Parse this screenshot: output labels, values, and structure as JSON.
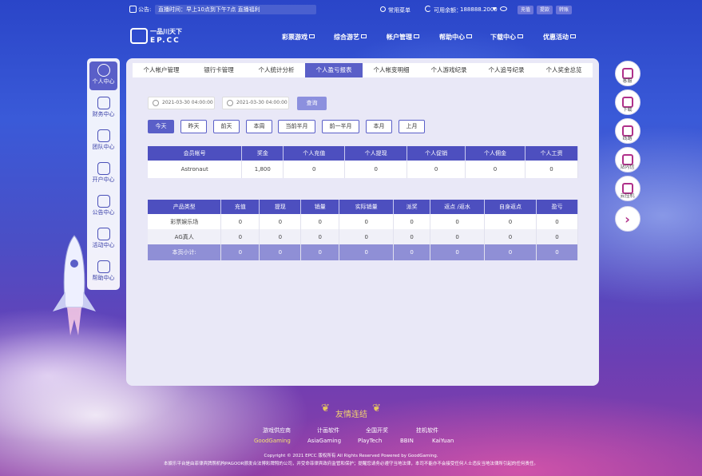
{
  "topbar": {
    "notice_label": "公告:",
    "notice_text": "直播时间：早上10点到下午7点 直播福利",
    "common_menu": "常用菜单",
    "balance_label": "可用余额：",
    "balance_value": "188888.2000",
    "buttons": [
      "充值",
      "提款",
      "转账"
    ]
  },
  "logo": {
    "title": "一品川天下",
    "sub": "EP.CC"
  },
  "nav": [
    "彩票游戏",
    "综合游艺",
    "帐户管理",
    "帮助中心",
    "下载中心",
    "优惠活动"
  ],
  "left_sidebar": [
    "个人中心",
    "财务中心",
    "团队中心",
    "开户中心",
    "公告中心",
    "活动中心",
    "帮助中心"
  ],
  "right_sidebar": [
    "客服",
    "下载",
    "线路",
    "站内信",
    "云挂机"
  ],
  "tabs": [
    "个人帐户管理",
    "银行卡管理",
    "个人统计分析",
    "个人盈亏报表",
    "个人帐变明细",
    "个人游戏纪录",
    "个人追号纪录",
    "个人奖金总览"
  ],
  "active_tab": "个人盈亏报表",
  "dates": {
    "start": "2021-03-30 04:00:00",
    "end": "2021-03-30 04:00:00"
  },
  "query_label": "查询",
  "filters": [
    "今天",
    "昨天",
    "前天",
    "本周",
    "当前半月",
    "前一半月",
    "本月",
    "上月"
  ],
  "summary_table": {
    "headers": [
      "会员帐号",
      "奖金",
      "个人充值",
      "个人提现",
      "个人促销",
      "个人佣金",
      "个人工资"
    ],
    "row": [
      "Astronaut",
      "1,800",
      "0",
      "0",
      "0",
      "0",
      "0"
    ]
  },
  "product_table": {
    "headers": [
      "产品类型",
      "充值",
      "提现",
      "销量",
      "实际销量",
      "派奖",
      "返点 /返水",
      "自身返点",
      "盈亏"
    ],
    "rows": [
      [
        "彩票娱乐场",
        "0",
        "0",
        "0",
        "0",
        "0",
        "0",
        "0",
        "0"
      ],
      [
        "AG真人",
        "0",
        "0",
        "0",
        "0",
        "0",
        "0",
        "0",
        "0"
      ]
    ],
    "subtotal": [
      "本页小计:",
      "0",
      "0",
      "0",
      "0",
      "0",
      "0",
      "0",
      "0"
    ]
  },
  "footer": {
    "friend_title": "友情连结",
    "links_row1": [
      "游戏供应商",
      "计画软件",
      "全国开奖",
      "挂机软件"
    ],
    "links_row2": [
      "GoodGaming",
      "AsiaGaming",
      "PlayTech",
      "BBIN",
      "KaiYuan"
    ],
    "copyright": "Copyright © 2021 EPCC 版权所有 All Rights Reserved Powered by GoodGaming.",
    "disclaimer": "本娱乐平台是由菲律宾牌照机构PAGOOR颁发合法博彩牌照的公司，并受命菲律宾政府监管和保护；提醒您请务必遵守当地法律，本司不能亦不会接受任何人士违反当地法律所引起的任何责任。"
  }
}
